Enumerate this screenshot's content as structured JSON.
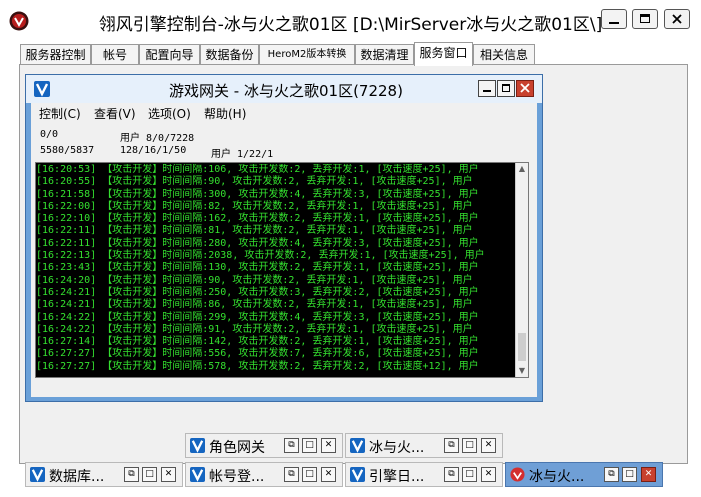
{
  "window": {
    "title": "翎风引擎控制台-冰与火之歌01区 [D:\\MirServer冰与火之歌01区\\]"
  },
  "tabs": [
    "服务器控制",
    "帐号",
    "配置向导",
    "数据备份",
    "HeroM2版本转换",
    "数据清理",
    "服务窗口",
    "相关信息"
  ],
  "active_tab": "服务窗口",
  "gateway": {
    "title": "游戏网关 - 冰与火之歌01区(7228)",
    "menu": [
      "控制(C)",
      "查看(V)",
      "选项(O)",
      "帮助(H)"
    ],
    "stats": {
      "r1c1": "0/0",
      "r1c2": "用户 8/0/7228",
      "r2c1": "5580/5837",
      "r2c2": "128/16/1/50",
      "r2c3": "用户 1/22/1"
    },
    "log": [
      "[16:20:53] 【攻击开发】时间间隔:106, 攻击开发数:2, 丢弃开发:1, [攻击速度+25], 用户",
      "[16:20:55] 【攻击开发】时间间隔:90, 攻击开发数:2, 丢弃开发:1, [攻击速度+25], 用户",
      "[16:21:58] 【攻击开发】时间间隔:300, 攻击开发数:4, 丢弃开发:3, [攻击速度+25], 用户",
      "[16:22:00] 【攻击开发】时间间隔:82, 攻击开发数:2, 丢弃开发:1, [攻击速度+25], 用户",
      "[16:22:10] 【攻击开发】时间间隔:162, 攻击开发数:2, 丢弃开发:1, [攻击速度+25], 用户",
      "[16:22:11] 【攻击开发】时间间隔:81, 攻击开发数:2, 丢弃开发:1, [攻击速度+25], 用户",
      "[16:22:11] 【攻击开发】时间间隔:280, 攻击开发数:4, 丢弃开发:3, [攻击速度+25], 用户",
      "[16:22:13] 【攻击开发】时间间隔:2038, 攻击开发数:2, 丢弃开发:1, [攻击速度+25], 用户",
      "[16:23:43] 【攻击开发】时间间隔:130, 攻击开发数:2, 丢弃开发:1, [攻击速度+25], 用户",
      "[16:24:20] 【攻击开发】时间间隔:90, 攻击开发数:2, 丢弃开发:1, [攻击速度+25], 用户",
      "[16:24:21] 【攻击开发】时间间隔:250, 攻击开发数:3, 丢弃开发:2, [攻击速度+25], 用户",
      "[16:24:21] 【攻击开发】时间间隔:86, 攻击开发数:2, 丢弃开发:1, [攻击速度+25], 用户",
      "[16:24:22] 【攻击开发】时间间隔:299, 攻击开发数:4, 丢弃开发:3, [攻击速度+25], 用户",
      "[16:24:22] 【攻击开发】时间间隔:91, 攻击开发数:2, 丢弃开发:1, [攻击速度+25], 用户",
      "[16:27:14] 【攻击开发】时间间隔:142, 攻击开发数:2, 丢弃开发:1, [攻击速度+25], 用户",
      "[16:27:27] 【攻击开发】时间间隔:556, 攻击开发数:7, 丢弃开发:6, [攻击速度+25], 用户",
      "[16:27:27] 【攻击开发】时间间隔:578, 攻击开发数:2, 丢弃开发:2, [攻击速度+12], 用户"
    ]
  },
  "taskbar": [
    {
      "label": "角色网关"
    },
    {
      "label": "冰与火..."
    },
    {
      "label": "数据库..."
    },
    {
      "label": "帐号登..."
    },
    {
      "label": "引擎日..."
    },
    {
      "label": "冰与火..."
    }
  ],
  "colors": {
    "console_text": "#34e02f",
    "frame_blue": "#6aa0d8",
    "close_red": "#c8412f"
  }
}
